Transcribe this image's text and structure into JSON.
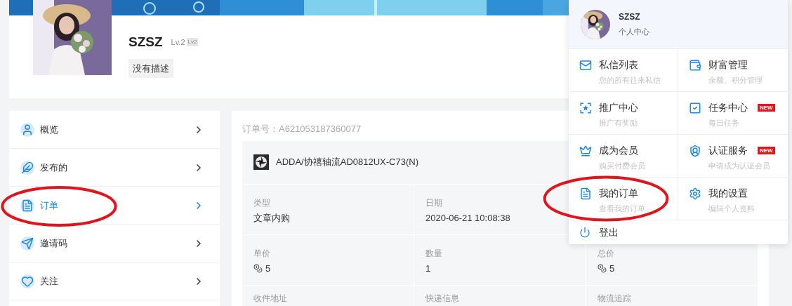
{
  "profile": {
    "name": "SZSZ",
    "level": "Lv.2",
    "level_badge": "Lv2",
    "description": "没有描述"
  },
  "sidebar": {
    "items": [
      {
        "label": "概览",
        "selected": false,
        "circled": false
      },
      {
        "label": "发布的",
        "selected": false,
        "circled": false
      },
      {
        "label": "订单",
        "selected": true,
        "circled": true
      },
      {
        "label": "邀请码",
        "selected": false,
        "circled": false
      },
      {
        "label": "关注",
        "selected": false,
        "circled": false
      }
    ]
  },
  "order": {
    "number": "订单号：A621053187360077",
    "product": "ADDA/协禧轴流AD0812UX-C73(N)",
    "rows": [
      [
        {
          "label": "类型",
          "value": "文章内购",
          "kind": "text"
        },
        {
          "label": "日期",
          "value": "2020-06-21 10:08:38",
          "kind": "text"
        }
      ],
      [
        {
          "label": "单价",
          "value": "5",
          "kind": "coins"
        },
        {
          "label": "数量",
          "value": "1",
          "kind": "text"
        },
        {
          "label": "总价",
          "value": "5",
          "kind": "coins"
        }
      ],
      [
        {
          "label": "收件地址",
          "kind": "label"
        },
        {
          "label": "快递信息",
          "kind": "label"
        },
        {
          "label": "物流追踪",
          "kind": "label"
        }
      ]
    ]
  },
  "user_menu": {
    "name": "SZSZ",
    "subtitle": "个人中心",
    "items": [
      {
        "title": "私信列表",
        "subtitle": "您的所有往来私信",
        "circled": false
      },
      {
        "title": "财富管理",
        "subtitle": "余额、积分管理",
        "circled": false
      },
      {
        "title": "推广中心",
        "subtitle": "推广有奖励",
        "circled": false
      },
      {
        "title": "任务中心",
        "subtitle": "每日任务",
        "badge": "NEW",
        "circled": false
      },
      {
        "title": "成为会员",
        "subtitle": "购买付费会员",
        "circled": false
      },
      {
        "title": "认证服务",
        "subtitle": "申请成为认证会员",
        "badge": "NEW",
        "circled": false
      },
      {
        "title": "我的订单",
        "subtitle": "查看我的订单",
        "circled": true
      },
      {
        "title": "我的设置",
        "subtitle": "编辑个人资料",
        "circled": false
      }
    ],
    "logout": "登出"
  }
}
